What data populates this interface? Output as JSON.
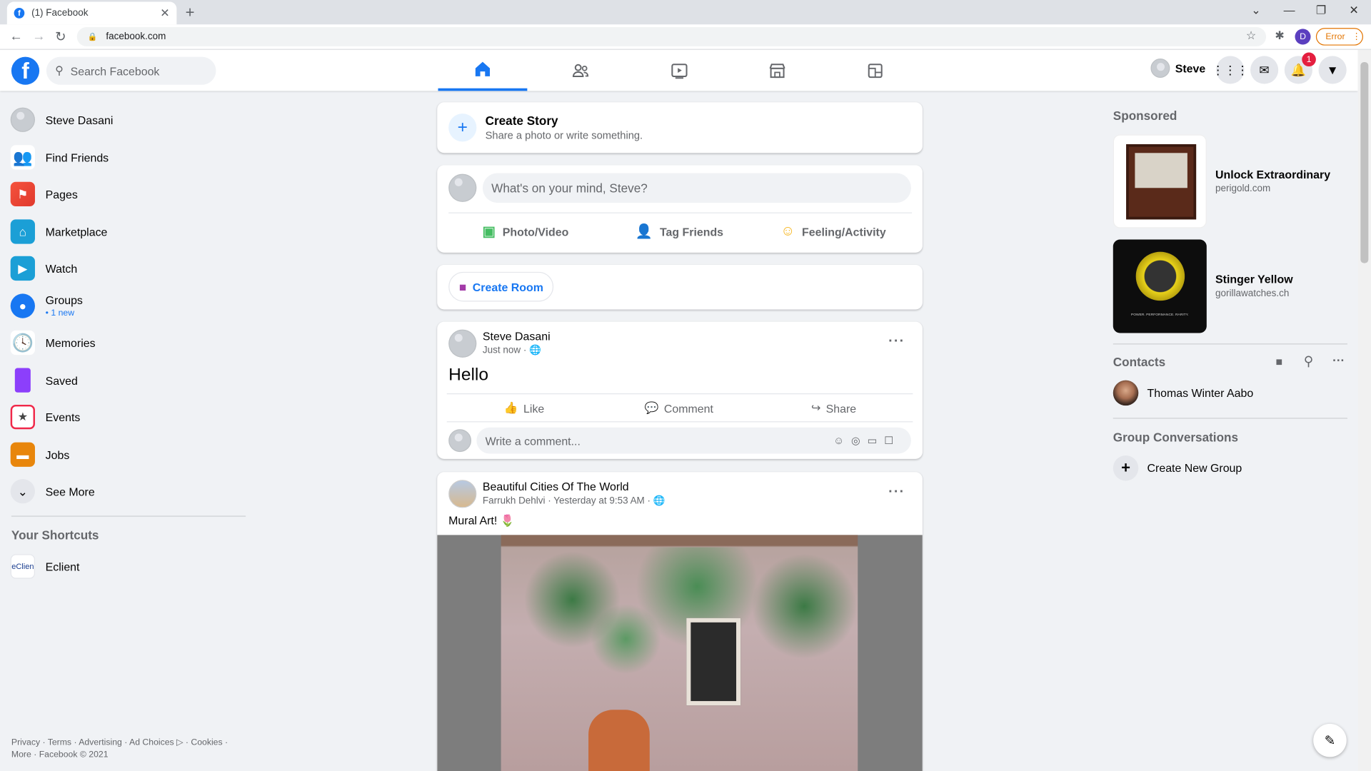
{
  "browser": {
    "tab_title": "(1) Facebook",
    "url": "facebook.com",
    "error_label": "Error",
    "profile_initial": "D"
  },
  "header": {
    "search_placeholder": "Search Facebook",
    "user_name": "Steve",
    "notification_count": "1"
  },
  "left_nav": {
    "items": [
      {
        "label": "Steve Dasani",
        "icon": "avatar"
      },
      {
        "label": "Find Friends",
        "icon": "friends-icon"
      },
      {
        "label": "Pages",
        "icon": "flag-icon"
      },
      {
        "label": "Marketplace",
        "icon": "shop-icon"
      },
      {
        "label": "Watch",
        "icon": "play-icon"
      },
      {
        "label": "Groups",
        "icon": "groups-icon",
        "sub": "• 1 new"
      },
      {
        "label": "Memories",
        "icon": "clock-icon"
      },
      {
        "label": "Saved",
        "icon": "bookmark-icon"
      },
      {
        "label": "Events",
        "icon": "calendar-icon"
      },
      {
        "label": "Jobs",
        "icon": "briefcase-icon"
      },
      {
        "label": "See More",
        "icon": "chevron-down-icon"
      }
    ],
    "shortcuts_heading": "Your Shortcuts",
    "shortcuts": [
      {
        "label": "Eclient",
        "thumb": "eClien"
      }
    ],
    "footer": "Privacy · Terms · Advertising · Ad Choices ▷ · Cookies · More · Facebook © 2021"
  },
  "feed": {
    "create_story_title": "Create Story",
    "create_story_sub": "Share a photo or write something.",
    "composer_placeholder": "What's on your mind, Steve?",
    "composer_actions": [
      "Photo/Video",
      "Tag Friends",
      "Feeling/Activity"
    ],
    "create_room": "Create Room",
    "post1": {
      "author": "Steve Dasani",
      "time": "Just now ·",
      "text": "Hello",
      "actions": [
        "Like",
        "Comment",
        "Share"
      ],
      "comment_placeholder": "Write a comment..."
    },
    "post2": {
      "group": "Beautiful Cities Of The World",
      "meta": "Farrukh Dehlvi · Yesterday at 9:53 AM ·",
      "text": "Mural Art! 🌷"
    }
  },
  "right": {
    "sponsored": "Sponsored",
    "ads": [
      {
        "title": "Unlock Extraordinary",
        "domain": "perigold.com"
      },
      {
        "title": "Stinger Yellow",
        "domain": "gorillawatches.ch",
        "img_text": "POWER. PERFORMANCE. RARITY."
      }
    ],
    "contacts_heading": "Contacts",
    "contacts": [
      {
        "name": "Thomas Winter Aabo"
      }
    ],
    "group_conv_heading": "Group Conversations",
    "create_group": "Create New Group"
  },
  "colors": {
    "accent": "#1877f2",
    "bg": "#f0f2f5"
  }
}
